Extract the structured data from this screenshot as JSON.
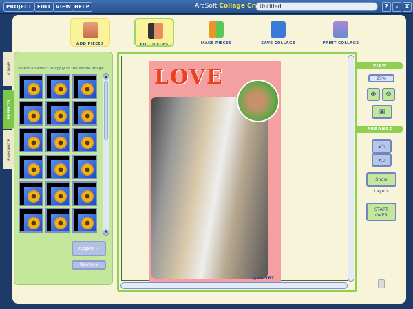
{
  "menu": [
    "PROJECT",
    "EDIT",
    "VIEW",
    "HELP"
  ],
  "app": {
    "brand": "ArcSoft",
    "product": "Collage Creator",
    "document": "Untitled"
  },
  "window_buttons": [
    "?",
    "–",
    "X"
  ],
  "toolbar": [
    {
      "label": "ADD PIECES",
      "icon": "add-pieces-icon"
    },
    {
      "label": "EDIT PIECES",
      "icon": "scissors-icon"
    },
    {
      "label": "MAKE PIECES",
      "icon": "make-pieces-icon"
    },
    {
      "label": "SAVE COLLAGE",
      "icon": "floppy-disk-icon"
    },
    {
      "label": "PRINT COLLAGE",
      "icon": "printer-icon"
    }
  ],
  "tabs": [
    "CROP",
    "EFFECTS",
    "ENHANCE"
  ],
  "effects": {
    "hint": "Select an effect to apply to the active image.",
    "count": 18,
    "apply": "Apply ✓",
    "restore": "Restore"
  },
  "collage": {
    "title": "LOVE",
    "watermark": "для iXBT"
  },
  "view": {
    "header": "VIEW",
    "zoom": "25%"
  },
  "arrange": {
    "header": "ARRANGE",
    "show_layers": "Show Layers",
    "start_over": "START OVER"
  },
  "colors": {
    "accent_green": "#8fcf52",
    "panel_green": "#c4e79c",
    "page_pink": "#f4a0a0",
    "frame_blue": "#1d3a68"
  }
}
